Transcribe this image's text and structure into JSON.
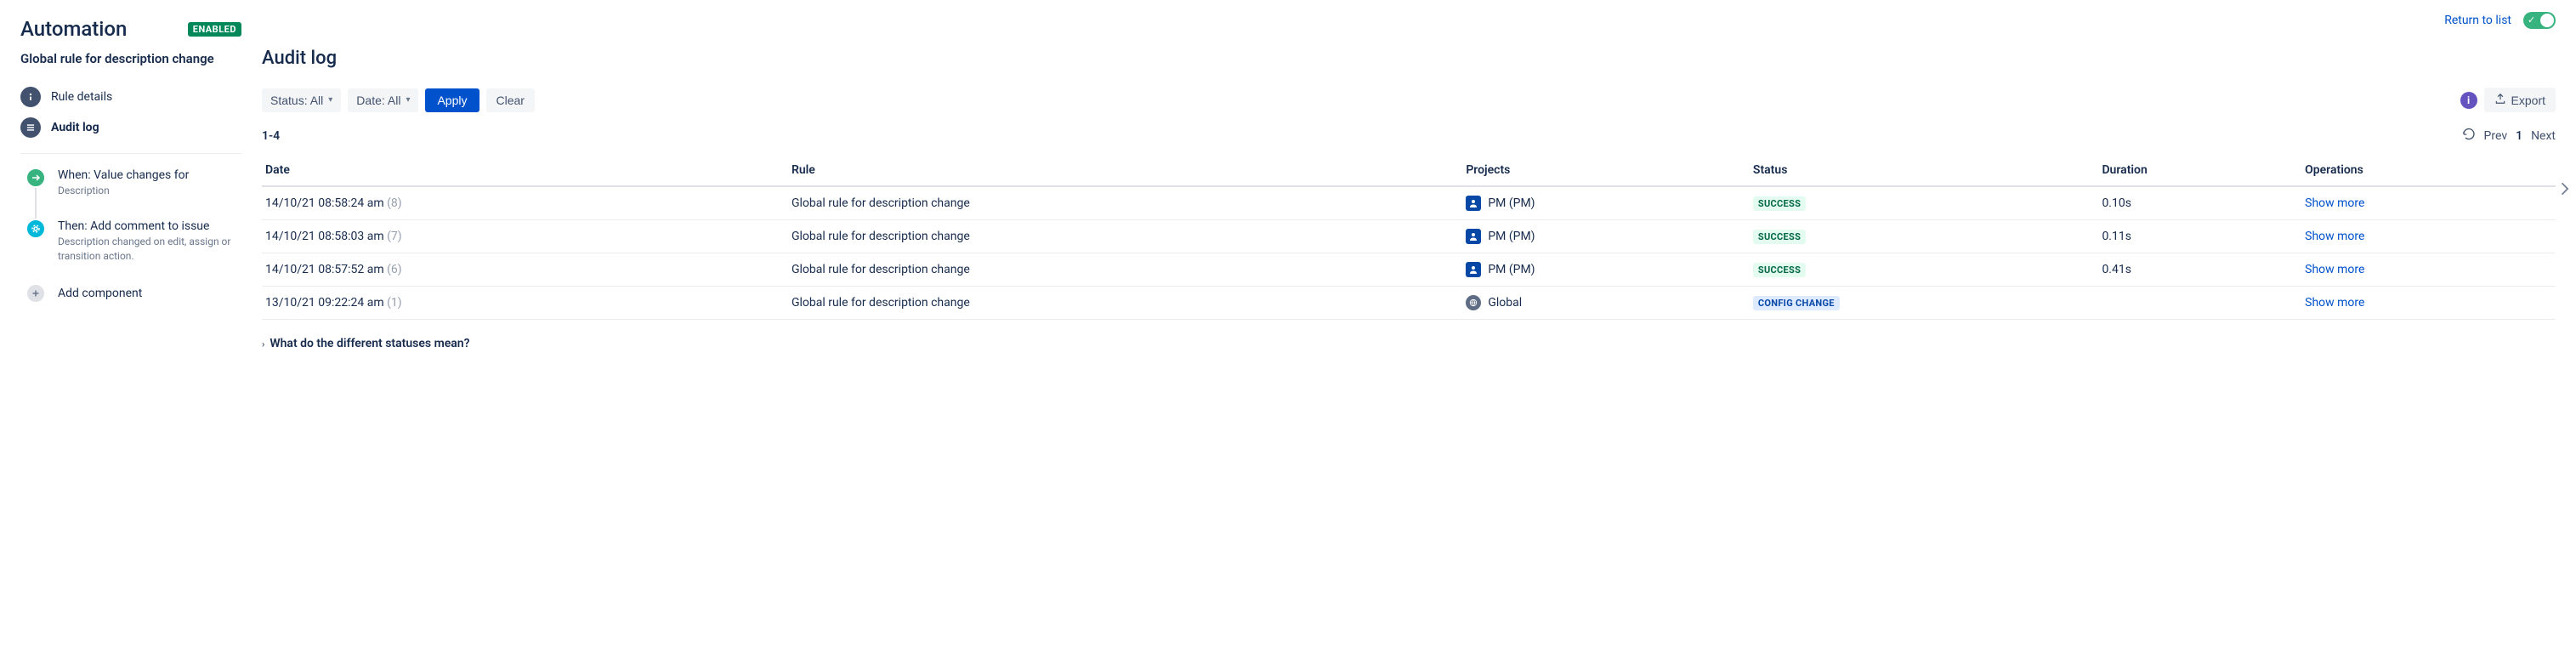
{
  "sidebar": {
    "title": "Automation",
    "enabled_badge": "ENABLED",
    "rule_name": "Global rule for description change",
    "nav": {
      "details": "Rule details",
      "audit_log": "Audit log"
    },
    "steps": [
      {
        "title": "When: Value changes for",
        "desc": "Description"
      },
      {
        "title": "Then: Add comment to issue",
        "desc": "Description changed on edit, assign or transition action."
      }
    ],
    "add_component": "Add component"
  },
  "header": {
    "return_link": "Return to list"
  },
  "main": {
    "title": "Audit log",
    "filters": {
      "status_label": "Status: All",
      "date_label": "Date: All",
      "apply": "Apply",
      "clear": "Clear",
      "export": "Export"
    },
    "count": "1-4",
    "pager": {
      "prev": "Prev",
      "page": "1",
      "next": "Next"
    },
    "columns": {
      "date": "Date",
      "rule": "Rule",
      "projects": "Projects",
      "status": "Status",
      "duration": "Duration",
      "operations": "Operations"
    },
    "rows": [
      {
        "date": "14/10/21 08:58:24 am",
        "seq": "(8)",
        "rule": "Global rule for description change",
        "project_type": "pm",
        "project": "PM (PM)",
        "status_type": "success",
        "status": "SUCCESS",
        "duration": "0.10s",
        "op": "Show more"
      },
      {
        "date": "14/10/21 08:58:03 am",
        "seq": "(7)",
        "rule": "Global rule for description change",
        "project_type": "pm",
        "project": "PM (PM)",
        "status_type": "success",
        "status": "SUCCESS",
        "duration": "0.11s",
        "op": "Show more"
      },
      {
        "date": "14/10/21 08:57:52 am",
        "seq": "(6)",
        "rule": "Global rule for description change",
        "project_type": "pm",
        "project": "PM (PM)",
        "status_type": "success",
        "status": "SUCCESS",
        "duration": "0.41s",
        "op": "Show more"
      },
      {
        "date": "13/10/21 09:22:24 am",
        "seq": "(1)",
        "rule": "Global rule for description change",
        "project_type": "global",
        "project": "Global",
        "status_type": "config",
        "status": "CONFIG CHANGE",
        "duration": "",
        "op": "Show more"
      }
    ],
    "expander": "What do the different statuses mean?"
  }
}
